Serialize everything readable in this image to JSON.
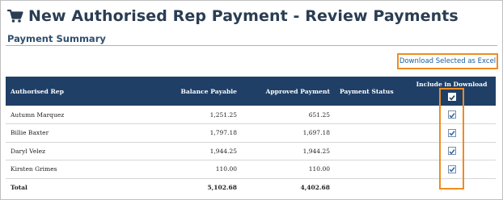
{
  "page": {
    "title": "New Authorised Rep Payment - Review Payments",
    "title_icon": "shopping-cart-icon",
    "section_title": "Payment Summary",
    "download_button_label": "Download Selected as Excel",
    "accent_color": "#f08c1e",
    "header_color": "#1f3f66"
  },
  "table": {
    "headers": {
      "name": "Authorised Rep",
      "balance": "Balance Payable",
      "approved": "Approved Payment",
      "status": "Payment Status",
      "include": "Include in Download"
    },
    "header_checkbox_checked": true,
    "rows": [
      {
        "name": "Autumn Marquez",
        "balance": "1,251.25",
        "approved": "651.25",
        "status": "",
        "included": true
      },
      {
        "name": "Billie Baxter",
        "balance": "1,797.18",
        "approved": "1,697.18",
        "status": "",
        "included": true
      },
      {
        "name": "Daryl Velez",
        "balance": "1,944.25",
        "approved": "1,944.25",
        "status": "",
        "included": true
      },
      {
        "name": "Kirsten Grimes",
        "balance": "110.00",
        "approved": "110.00",
        "status": "",
        "included": true
      }
    ],
    "total": {
      "label": "Total",
      "balance": "5,102.68",
      "approved": "4,402.68"
    }
  }
}
